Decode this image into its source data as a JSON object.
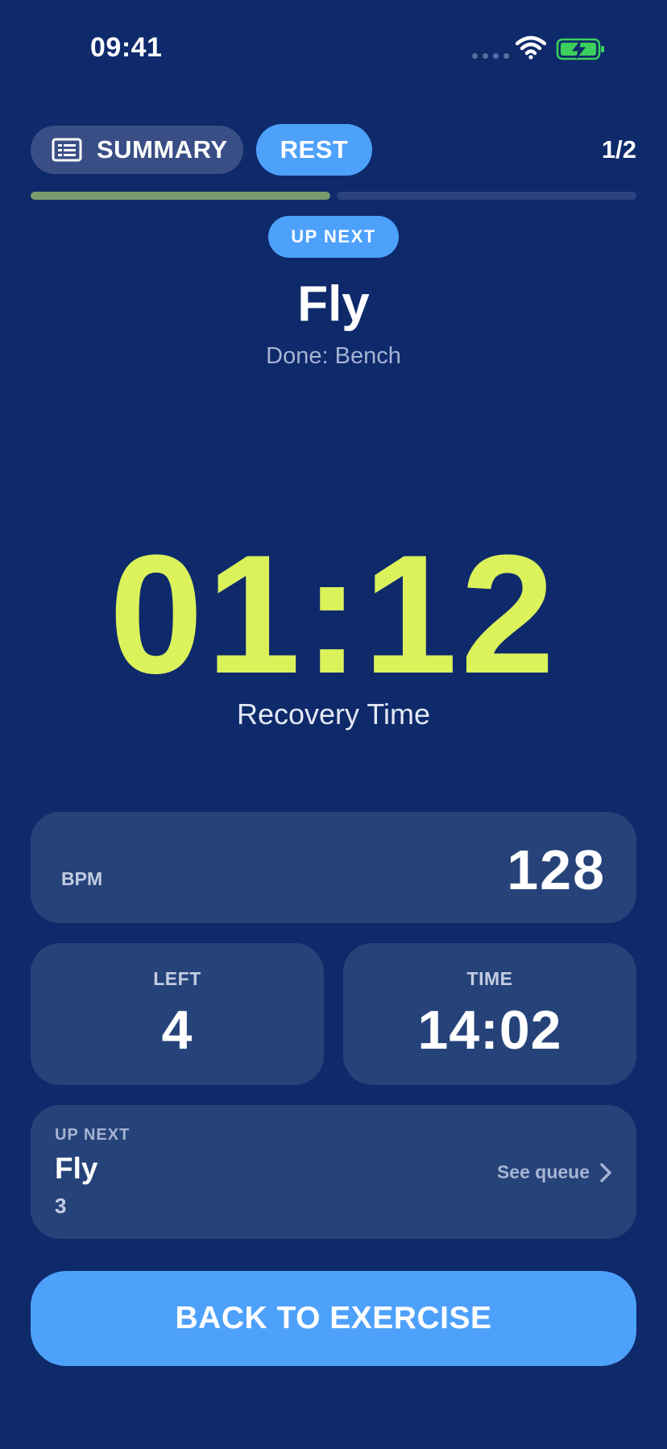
{
  "status_bar": {
    "time": "09:41",
    "icons": [
      "signal-dots-icon",
      "wifi-icon",
      "battery-charging-icon"
    ]
  },
  "header": {
    "summary_label": "SUMMARY",
    "summary_icon": "list-icon",
    "rest_label": "REST",
    "page_counter": "1/2",
    "progress": {
      "segments": [
        1.0,
        0.0
      ],
      "fill_color": "#7a9a6c",
      "track_color": "#2b437f"
    }
  },
  "upnext_header": {
    "badge": "UP NEXT",
    "title": "Fly",
    "done_text": "Done: Bench"
  },
  "timer": {
    "value": "01:12",
    "label": "Recovery Time",
    "color": "#dbf25b"
  },
  "stats": {
    "bpm": {
      "label": "BPM",
      "value": "128"
    },
    "left": {
      "label": "LEFT",
      "value": "4"
    },
    "time": {
      "label": "TIME",
      "value": "14:02"
    }
  },
  "queue": {
    "kicker": "UP NEXT",
    "name": "Fly",
    "count": "3",
    "see_label": "See queue",
    "icon": "chevron-right-icon"
  },
  "actions": {
    "back_label": "BACK TO EXERCISE"
  },
  "colors": {
    "background": "#0e2a6b",
    "card": "#264379",
    "accent": "#4ea1fb",
    "battery_green": "#3ccf5b"
  }
}
